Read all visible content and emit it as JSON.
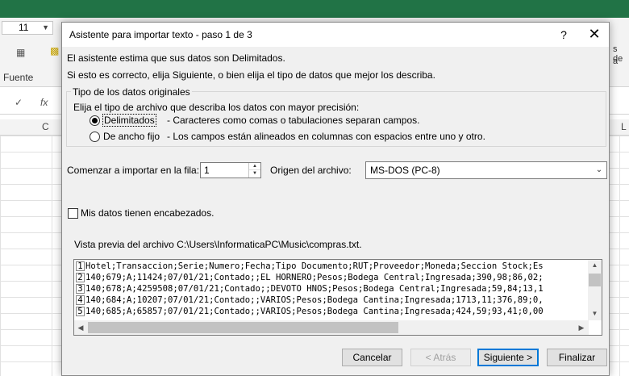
{
  "excel": {
    "font_size": "11",
    "font_group_label": "Fuente",
    "col_c": "C",
    "col_l": "L",
    "right_text": "s de",
    "right_text2": "a",
    "fx": "fx"
  },
  "dialog": {
    "title": "Asistente para importar texto - paso 1 de 3",
    "help": "?",
    "close": "✕",
    "line1": "El asistente estima que sus datos son Delimitados.",
    "line2": "Si esto es correcto, elija Siguiente, o bien elija el tipo de datos que mejor los describa.",
    "group_title": "Tipo de los datos originales",
    "group_prompt": "Elija el tipo de archivo que describa los datos con mayor precisión:",
    "options": [
      {
        "label": "Delimitados",
        "desc": "- Caracteres como comas o tabulaciones separan campos.",
        "selected": true
      },
      {
        "label": "De ancho fijo",
        "desc": "- Los campos están alineados en columnas con espacios entre uno y otro.",
        "selected": false
      }
    ],
    "start_row_label": "Comenzar a importar en la fila:",
    "start_row_value": "1",
    "origin_label": "Origen del archivo:",
    "origin_value": "MS-DOS (PC-8)",
    "headers_label": "Mis datos tienen encabezados.",
    "headers_checked": false,
    "preview_label": "Vista previa del archivo C:\\Users\\InformaticaPC\\Music\\compras.txt.",
    "preview_lines": [
      {
        "num": "1",
        "text": "Hotel;Transaccion;Serie;Numero;Fecha;Tipo Documento;RUT;Proveedor;Moneda;Seccion Stock;Es"
      },
      {
        "num": "2",
        "text": "140;679;A;11424;07/01/21;Contado;;EL HORNERO;Pesos;Bodega Central;Ingresada;390,98;86,02;"
      },
      {
        "num": "3",
        "text": "140;678;A;4259508;07/01/21;Contado;;DEVOTO HNOS;Pesos;Bodega Central;Ingresada;59,84;13,1"
      },
      {
        "num": "4",
        "text": "140;684;A;10207;07/01/21;Contado;;VARIOS;Pesos;Bodega Cantina;Ingresada;1713,11;376,89;0,"
      },
      {
        "num": "5",
        "text": "140;685;A;65857;07/01/21;Contado;;VARIOS;Pesos;Bodega Cantina;Ingresada;424,59;93,41;0,00"
      }
    ],
    "buttons": {
      "cancel": "Cancelar",
      "back": "< Atrás",
      "next": "Siguiente >",
      "finish": "Finalizar"
    }
  }
}
